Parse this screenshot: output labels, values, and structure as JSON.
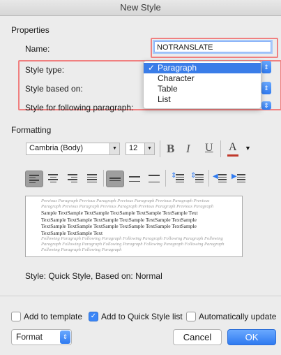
{
  "window": {
    "title": "New Style"
  },
  "properties": {
    "section_label": "Properties",
    "name_label": "Name:",
    "name_value": "NOTRANSLATE",
    "style_type_label": "Style type:",
    "style_based_on_label": "Style based on:",
    "following_paragraph_label": "Style for following paragraph:",
    "style_type_options": [
      "Paragraph",
      "Character",
      "Table",
      "List"
    ],
    "style_type_selected": "Paragraph",
    "check_mark": "✓"
  },
  "formatting": {
    "section_label": "Formatting",
    "font_name": "Cambria (Body)",
    "font_size": "12",
    "bold": "B",
    "italic": "I",
    "underline": "U",
    "font_color_glyph": "A",
    "font_color": "#c0392b"
  },
  "preview": {
    "previous_text": "Previous Paragraph Previous Paragraph Previous Paragraph Previous Paragraph Previous Paragraph Previous Paragraph Previous Paragraph Previous Paragraph Previous Paragraph",
    "sample_lines": [
      "Sample TextSample TextSample TextSample TextSample TextSample Text",
      "TextSample TextSample TextSample TextSample TextSample TextSample",
      "TextSample TextSample TextSample TextSample TextSample TextSample",
      "TextSample TextSample Text"
    ],
    "following_text": "Following Paragraph Following Paragraph Following Paragraph Following Paragraph Following Paragraph Following Paragraph Following Paragraph Following Paragraph Following Paragraph Following Paragraph Following Paragraph"
  },
  "style_description": "Style: Quick Style, Based on: Normal",
  "options": {
    "add_to_template": {
      "label": "Add to template",
      "checked": false
    },
    "add_to_quick_style": {
      "label": "Add to Quick Style list",
      "checked": true,
      "check_glyph": "✓"
    },
    "auto_update": {
      "label": "Automatically update",
      "checked": false
    }
  },
  "buttons": {
    "format": "Format",
    "cancel": "Cancel",
    "ok": "OK"
  },
  "icons": [
    "chevron-up-down-icon",
    "font-color-icon",
    "align-left-icon",
    "align-center-icon",
    "align-right-icon",
    "justify-icon",
    "single-spacing-icon",
    "one-half-spacing-icon",
    "double-spacing-icon",
    "space-before-icon",
    "space-after-icon",
    "decrease-indent-icon",
    "increase-indent-icon"
  ]
}
